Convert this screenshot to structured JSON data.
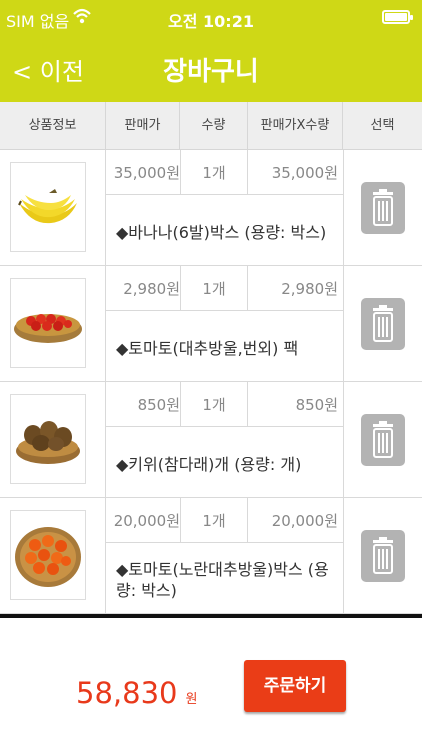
{
  "status_bar": {
    "carrier": "SIM 없음",
    "time": "오전 10:21",
    "battery_level": 0.9
  },
  "nav": {
    "back_label": "< 이전",
    "title": "장바구니"
  },
  "table_header": {
    "product_info": "상품정보",
    "price": "판매가",
    "quantity": "수량",
    "subtotal": "판매가X수량",
    "select": "선택"
  },
  "items": [
    {
      "price": "35,000원",
      "quantity": "1개",
      "subtotal": "35,000원",
      "name": "◆바나나(6발)박스 (용량: 박스)",
      "image": "banana"
    },
    {
      "price": "2,980원",
      "quantity": "1개",
      "subtotal": "2,980원",
      "name": "◆토마토(대추방울,번외) 팩",
      "image": "cherry-tomato-basket"
    },
    {
      "price": "850원",
      "quantity": "1개",
      "subtotal": "850원",
      "name": "◆키위(참다래)개 (용량: 개)",
      "image": "kiwi-basket"
    },
    {
      "price": "20,000원",
      "quantity": "1개",
      "subtotal": "20,000원",
      "name": "◆토마토(노란대추방울)박스 (용량: 박스)",
      "image": "orange-tomato-basket"
    }
  ],
  "footer": {
    "total": "58,830",
    "total_unit": "원",
    "order_label": "주문하기"
  },
  "colors": {
    "header": "#cfd816",
    "accent": "#ea3d17",
    "total_text": "#e8391b"
  }
}
